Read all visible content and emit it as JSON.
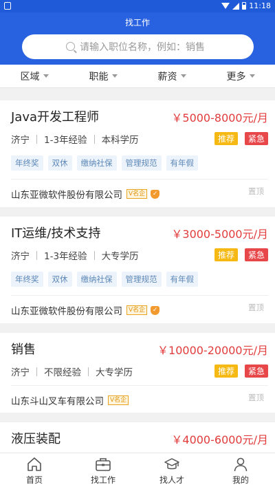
{
  "status": {
    "time": "11:18"
  },
  "header": {
    "title": "找工作",
    "search_placeholder": "请输入职位名称，例如：销售"
  },
  "filters": [
    "区域",
    "职能",
    "薪资",
    "更多"
  ],
  "jobs": [
    {
      "title": "Java开发工程师",
      "salary": "￥5000-8000元/月",
      "city": "济宁",
      "experience": "1-3年经验",
      "education": "本科学历",
      "badges": [
        "推荐",
        "紧急"
      ],
      "tags": [
        "年终奖",
        "双休",
        "缴纳社保",
        "管理规范",
        "有年假"
      ],
      "company": "山东亚微软件股份有限公司",
      "vip_label": "名企",
      "verified": true,
      "top_label": "置顶"
    },
    {
      "title": "IT运维/技术支持",
      "salary": "￥3000-5000元/月",
      "city": "济宁",
      "experience": "1-3年经验",
      "education": "大专学历",
      "badges": [
        "推荐",
        "紧急"
      ],
      "tags": [
        "年终奖",
        "双休",
        "缴纳社保",
        "管理规范",
        "有年假"
      ],
      "company": "山东亚微软件股份有限公司",
      "vip_label": "名企",
      "verified": true,
      "top_label": "置顶"
    },
    {
      "title": "销售",
      "salary": "￥10000-20000元/月",
      "city": "济宁",
      "experience": "不限经验",
      "education": "大专学历",
      "badges": [
        "推荐",
        "紧急"
      ],
      "company": "山东斗山叉车有限公司",
      "vip_label": "名企",
      "verified": false,
      "top_label": "置顶"
    },
    {
      "title": "液压装配",
      "salary": "￥4000-6000元/月"
    }
  ],
  "tabbar": [
    {
      "label": "首页",
      "icon": "home-icon"
    },
    {
      "label": "找工作",
      "icon": "briefcase-icon"
    },
    {
      "label": "找人才",
      "icon": "graduation-cap-icon"
    },
    {
      "label": "我的",
      "icon": "user-icon"
    }
  ],
  "colors": {
    "primary": "#2862e0",
    "salary": "#e23b3b",
    "recommend": "#f6b914",
    "urgent": "#e8474a"
  }
}
